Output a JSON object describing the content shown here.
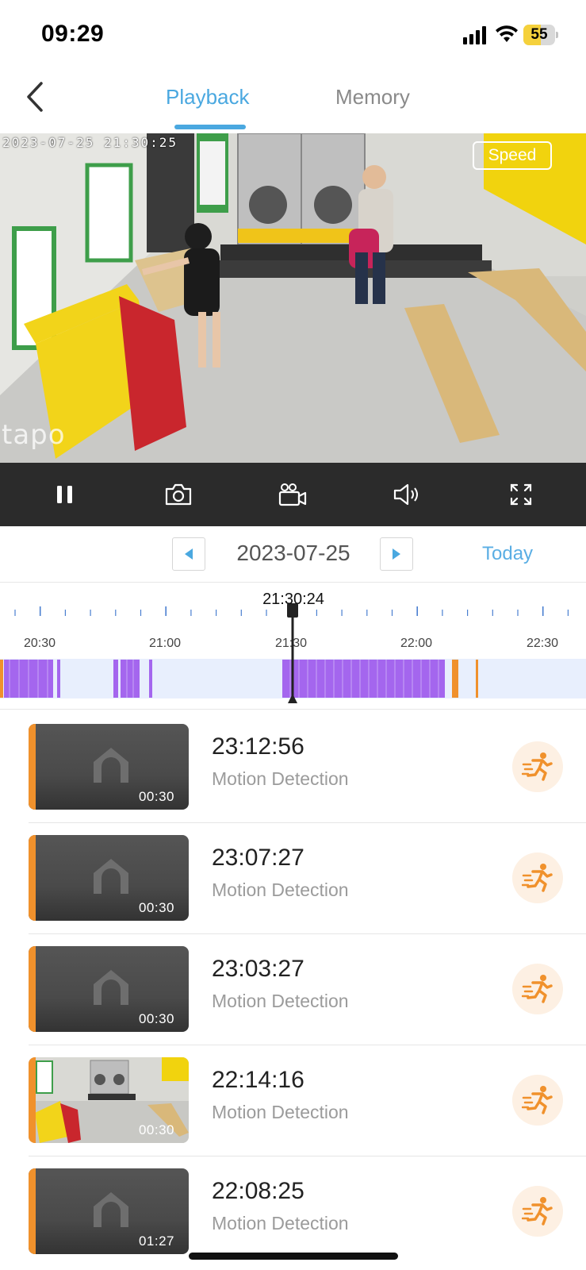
{
  "status_bar": {
    "time": "09:29",
    "battery": "55",
    "battery_level": 0.55,
    "signal_icon": "cellular-signal-icon",
    "wifi_icon": "wifi-icon"
  },
  "header": {
    "back_icon": "chevron-left-icon",
    "tabs": [
      {
        "label": "Playback",
        "active": true
      },
      {
        "label": "Memory",
        "active": false
      }
    ]
  },
  "video": {
    "timestamp": "2023-07-25 21:30:25",
    "speed_label": "Speed",
    "watermark": "tapo"
  },
  "controls": {
    "icons": [
      "pause-icon",
      "camera-snapshot-icon",
      "video-record-icon",
      "speaker-icon",
      "fullscreen-icon"
    ]
  },
  "date_nav": {
    "date": "2023-07-25",
    "today_label": "Today"
  },
  "timeline": {
    "current_time": "21:30:24",
    "labels": [
      "20:30",
      "21:00",
      "21:30",
      "22:00",
      "22:30"
    ]
  },
  "events": [
    {
      "time": "23:12:56",
      "type": "Motion Detection",
      "duration": "00:30",
      "has_preview": false
    },
    {
      "time": "23:07:27",
      "type": "Motion Detection",
      "duration": "00:30",
      "has_preview": false
    },
    {
      "time": "23:03:27",
      "type": "Motion Detection",
      "duration": "00:30",
      "has_preview": false
    },
    {
      "time": "22:14:16",
      "type": "Motion Detection",
      "duration": "00:30",
      "has_preview": true
    },
    {
      "time": "22:08:25",
      "type": "Motion Detection",
      "duration": "01:27",
      "has_preview": false
    }
  ],
  "colors": {
    "accent": "#4aa8e0",
    "timeline_motion": "#a466ee",
    "timeline_event": "#f0912c",
    "timeline_bg": "#e8effd",
    "badge_bg": "#fdf0e3"
  }
}
